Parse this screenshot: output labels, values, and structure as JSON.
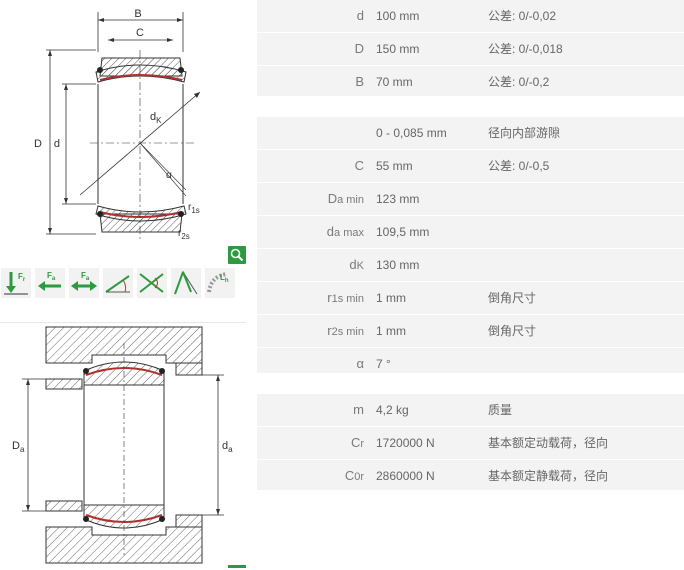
{
  "drawing_top": {
    "labels": {
      "B": "B",
      "C": "C",
      "D": "D",
      "d": "d",
      "dK": "d",
      "dK_sub": "K",
      "alpha": "α",
      "r1s": "r",
      "r1s_sub": "1s",
      "r2s": "r",
      "r2s_sub": "2s"
    }
  },
  "drawing_bottom": {
    "labels": {
      "Da": "D",
      "Da_sub": "a",
      "da": "d",
      "da_sub": "a"
    }
  },
  "load_icons": [
    {
      "name": "radial-load-icon",
      "label": "F",
      "sub": "r"
    },
    {
      "name": "axial-load-left-icon",
      "label": "F",
      "sub": "a"
    },
    {
      "name": "axial-load-both-icon",
      "label": "F",
      "sub": "a"
    },
    {
      "name": "tilt-angle-icon",
      "label": ""
    },
    {
      "name": "oscillation-angle-icon",
      "label": ""
    },
    {
      "name": "tilting-icon",
      "label": ""
    },
    {
      "name": "life-icon",
      "label": "L",
      "sub": "h"
    }
  ],
  "colors": {
    "accent": "#2c9b3f",
    "row_bg": "#f3f3f3",
    "text": "#666666",
    "symbol": "#7a7a7a",
    "red": "#c0392b"
  },
  "table1": [
    {
      "sym": "d",
      "sub": "",
      "value": "100  mm",
      "desc": "公差: 0/-0,02"
    },
    {
      "sym": "D",
      "sub": "",
      "value": "150  mm",
      "desc": "公差: 0/-0,018"
    },
    {
      "sym": "B",
      "sub": "",
      "value": "70  mm",
      "desc": "公差: 0/-0,2"
    }
  ],
  "table2": [
    {
      "sym": "",
      "sub": "",
      "value": "0 - 0,085  mm",
      "desc": "径向内部游隙"
    },
    {
      "sym": "C",
      "sub": "",
      "value": "55  mm",
      "desc": "公差: 0/-0,5"
    },
    {
      "sym": "D",
      "sub": "a min",
      "value": "123  mm",
      "desc": ""
    },
    {
      "sym": "d",
      "sub": "a max",
      "value": "109,5  mm",
      "desc": ""
    },
    {
      "sym": "d",
      "sub": "K",
      "value": "130  mm",
      "desc": ""
    },
    {
      "sym": "r",
      "sub": "1s min",
      "value": "1  mm",
      "desc": "倒角尺寸"
    },
    {
      "sym": "r",
      "sub": "2s min",
      "value": "1  mm",
      "desc": "倒角尺寸"
    },
    {
      "sym": "α",
      "sub": "",
      "value": "7  °",
      "desc": ""
    }
  ],
  "table3": [
    {
      "sym": "m",
      "sub": "",
      "value": "4,2  kg",
      "desc": "质量"
    },
    {
      "sym": "C",
      "sub": "r",
      "value": "1720000  N",
      "desc": "基本额定动载荷，径向"
    },
    {
      "sym": "C",
      "sub": "0r",
      "value": "2860000  N",
      "desc": "基本额定静载荷，径向"
    }
  ]
}
